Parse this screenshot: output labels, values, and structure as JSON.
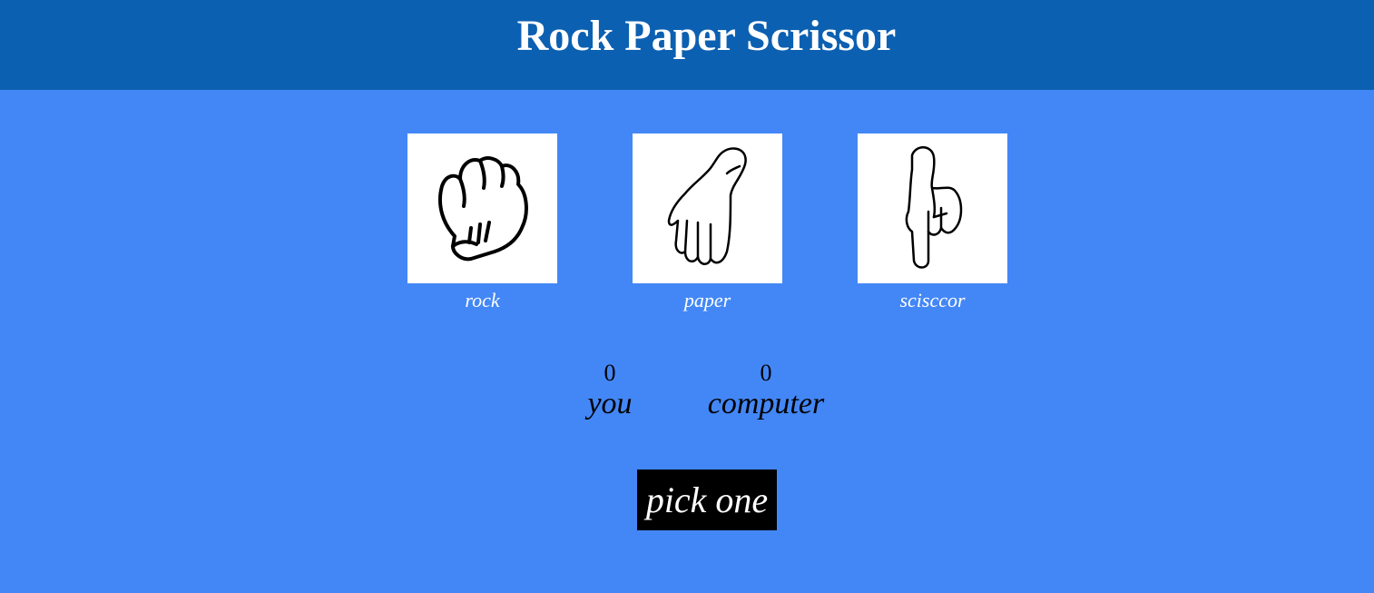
{
  "header": {
    "title": "Rock Paper Scrissor"
  },
  "choices": [
    {
      "id": "rock",
      "label": "rock",
      "icon": "fist-icon"
    },
    {
      "id": "paper",
      "label": "paper",
      "icon": "open-hand-icon"
    },
    {
      "id": "scissor",
      "label": "scisccor",
      "icon": "pointing-hand-icon"
    }
  ],
  "scoreboard": {
    "user": {
      "score": "0",
      "label": "you"
    },
    "computer": {
      "score": "0",
      "label": "computer"
    }
  },
  "message": "pick one",
  "colors": {
    "header_bg": "#0c60b1",
    "page_bg": "#4387f6",
    "message_bg": "#000000"
  }
}
